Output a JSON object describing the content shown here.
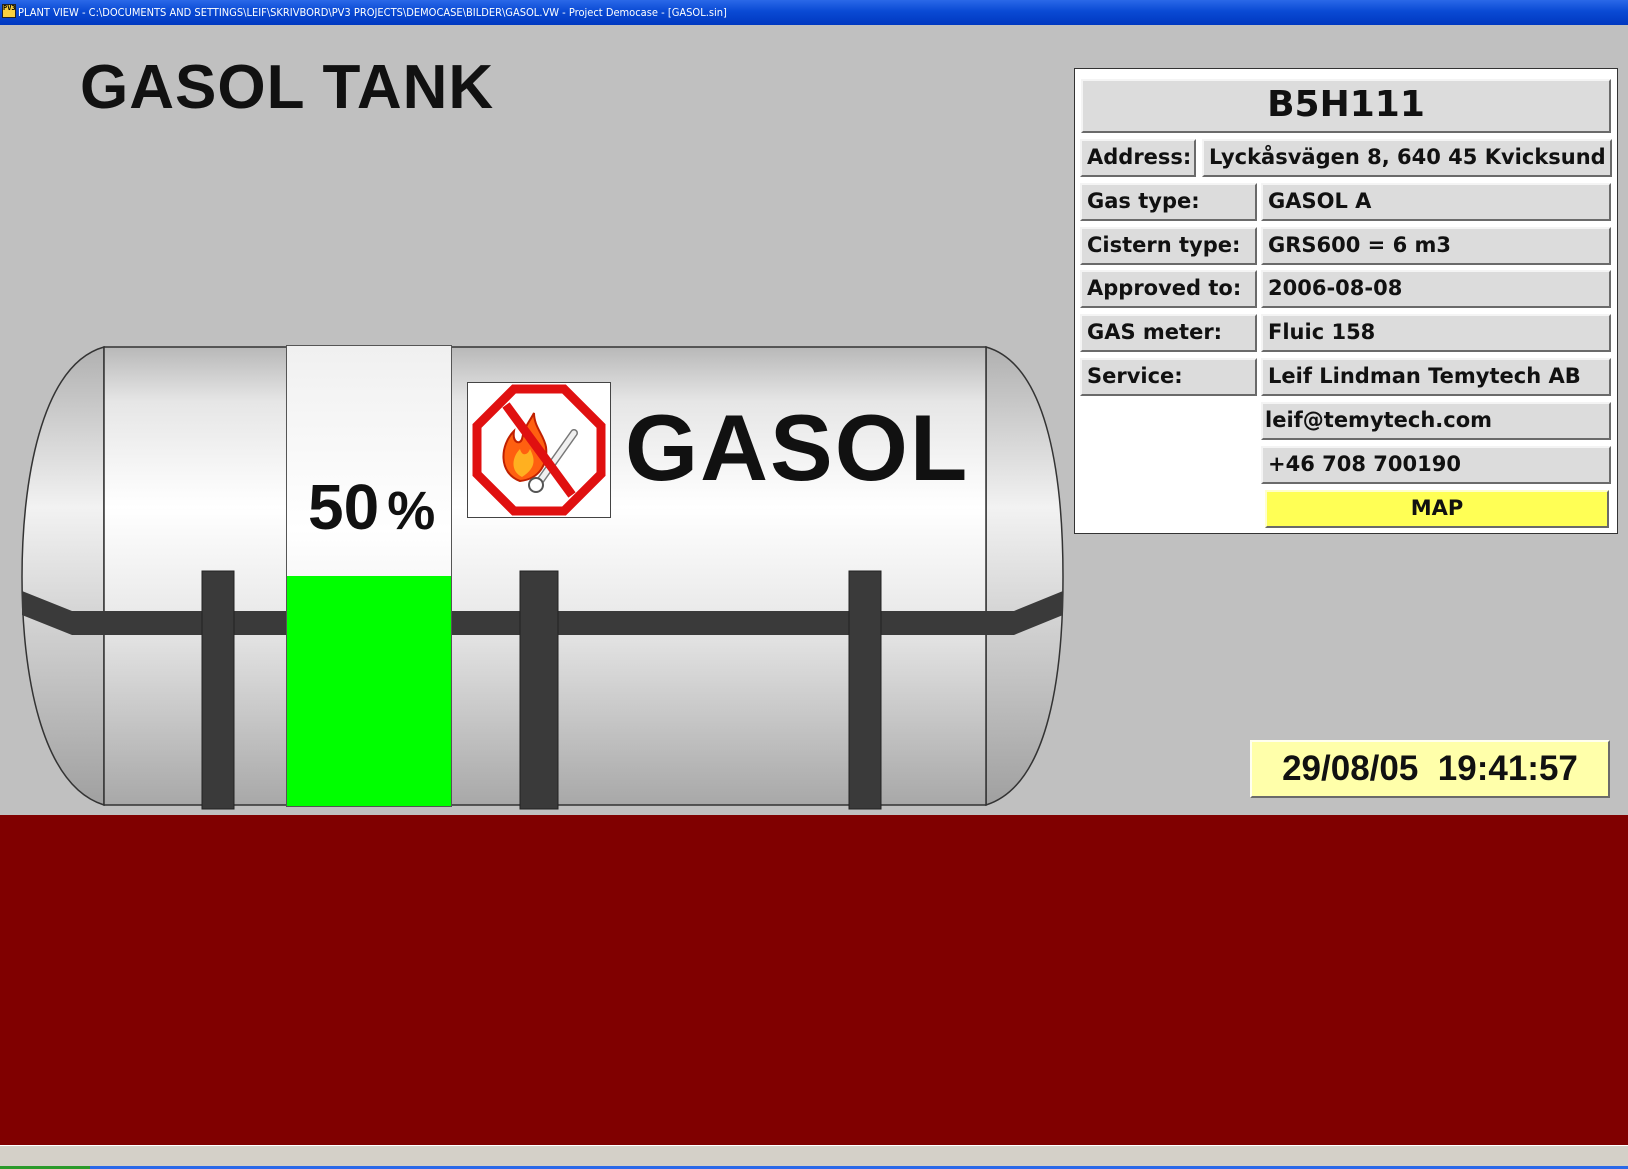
{
  "window": {
    "title": "PLANT VIEW - C:\\DOCUMENTS AND SETTINGS\\LEIF\\SKRIVBORD\\PV3 PROJECTS\\DEMOCASE\\BILDER\\GASOL.VW - Project Democase - [GASOL.sin]",
    "icon_text": "PV3"
  },
  "page": {
    "title": "GASOL TANK"
  },
  "tank": {
    "label": "GASOL",
    "level_value": "50",
    "level_unit": "%",
    "level_fraction": 0.5,
    "fill_color": "#00ff00",
    "warning_sign": "no-fire-icon"
  },
  "info": {
    "id": "B5H111",
    "address_label": "Address:",
    "address_value": "Lyckåsvägen 8, 640 45 Kvicksund",
    "gas_type_label": "Gas type:",
    "gas_type_value": "GASOL A",
    "cistern_type_label": "Cistern type:",
    "cistern_type_value": "GRS600 = 6 m3",
    "approved_label": "Approved to:",
    "approved_value": "2006-08-08",
    "gas_meter_label": "GAS meter:",
    "gas_meter_value": "Fluic 158",
    "service_label": "Service:",
    "service_value": "Leif Lindman Temytech AB",
    "email": "leif@temytech.com",
    "phone": "+46 708 700190",
    "map_button": "MAP"
  },
  "clock": {
    "datetime": "29/08/05  19:41:57"
  },
  "colors": {
    "background": "#c0c0c0",
    "ground": "#800000",
    "map_button": "#ffff55",
    "clock_bg": "#ffffaa",
    "level_fill": "#00ff00"
  }
}
